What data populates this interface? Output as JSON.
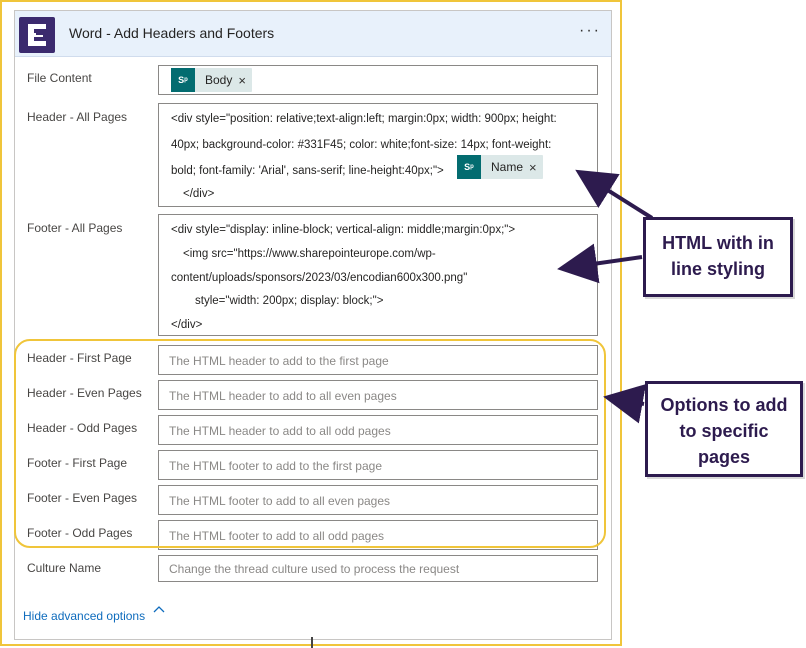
{
  "card": {
    "title": "Word - Add Headers and Footers",
    "more_label": "···"
  },
  "fields": {
    "file_content": {
      "label": "File Content",
      "token": {
        "icon": "sharepoint-icon",
        "text": "Body",
        "close": "×"
      }
    },
    "header_all": {
      "label": "Header - All Pages",
      "lines": [
        "<div style=\"position: relative;text-align:left; margin:0px; width: 900px; height:",
        "40px; background-color: #331F45; color: white;font-size: 14px; font-weight:",
        "bold; font-family: 'Arial', sans-serif; line-height:40px;\">",
        "</div>"
      ],
      "token": {
        "icon": "sharepoint-icon",
        "text": "Name",
        "close": "×"
      }
    },
    "footer_all": {
      "label": "Footer - All Pages",
      "lines": [
        "<div style=\"display: inline-block; vertical-align: middle;margin:0px;\">",
        "<img src=\"https://www.sharepointeurope.com/wp-",
        "content/uploads/sponsors/2023/03/encodian600x300.png\"",
        "style=\"width: 200px; display: block;\">",
        "</div>"
      ]
    },
    "header_first": {
      "label": "Header - First Page",
      "placeholder": "The HTML header to add to the first page"
    },
    "header_even": {
      "label": "Header - Even Pages",
      "placeholder": "The HTML header to add to all even pages"
    },
    "header_odd": {
      "label": "Header - Odd Pages",
      "placeholder": "The HTML header to add to all odd pages"
    },
    "footer_first": {
      "label": "Footer - First Page",
      "placeholder": "The HTML footer to add to the first page"
    },
    "footer_even": {
      "label": "Footer - Even Pages",
      "placeholder": "The HTML footer to add to all even pages"
    },
    "footer_odd": {
      "label": "Footer - Odd Pages",
      "placeholder": "The HTML footer to add to all odd pages"
    },
    "culture": {
      "label": "Culture Name",
      "placeholder": "Change the thread culture used to process the request"
    }
  },
  "advanced_link": "Hide advanced options",
  "callouts": {
    "html_inline": [
      "HTML with in",
      "line styling"
    ],
    "options": [
      "Options to add",
      "to specific",
      "pages"
    ]
  },
  "colors": {
    "accent_yellow": "#f0c53a",
    "callout_purple": "#2d1b4e",
    "logo_purple": "#3b2a6e",
    "sharepoint_teal": "#036c70",
    "link_blue": "#0f6cbd"
  }
}
